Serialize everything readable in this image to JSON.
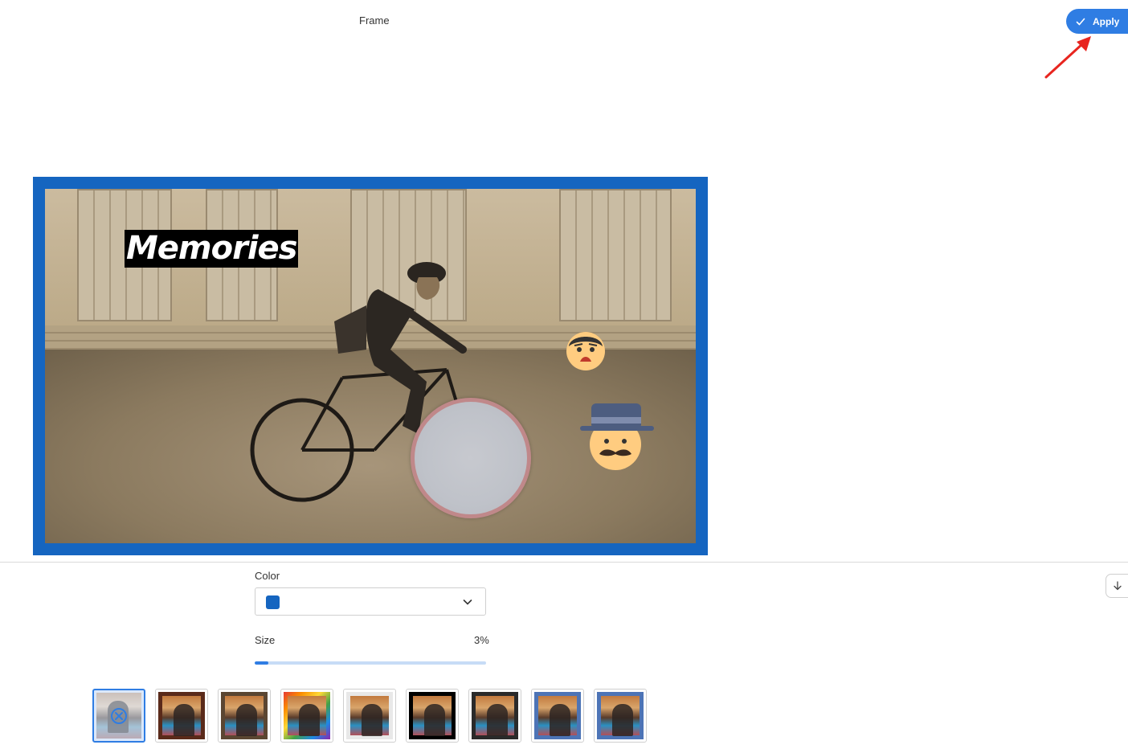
{
  "header": {
    "title": "Frame"
  },
  "toolbar": {
    "apply_label": "Apply"
  },
  "canvas": {
    "frame_color": "#1565c0",
    "overlay_text": "Memories",
    "stickers": [
      "worried-face-sticker",
      "man-with-hat-sticker"
    ],
    "blur_circle": "blur-circle"
  },
  "settings": {
    "color_label": "Color",
    "color_value": "#1565c0",
    "size_label": "Size",
    "size_value": "3%",
    "size_fraction": 0.06
  },
  "thumbnails": [
    {
      "id": "none",
      "selected": true
    },
    {
      "id": "frame-1",
      "selected": false,
      "border": "#5a2a1a"
    },
    {
      "id": "frame-2",
      "selected": false,
      "border": "#5b4632"
    },
    {
      "id": "frame-3",
      "selected": false,
      "border": "rainbow"
    },
    {
      "id": "frame-4",
      "selected": false,
      "border": "#e8e8e8"
    },
    {
      "id": "frame-5",
      "selected": false,
      "border": "#000000"
    },
    {
      "id": "frame-6",
      "selected": false,
      "border": "#2a2a2a"
    },
    {
      "id": "frame-7",
      "selected": false,
      "border": "#4d74b6"
    },
    {
      "id": "frame-8",
      "selected": false,
      "border": "#4d74b6"
    }
  ],
  "colors": {
    "accent": "#2f7de3",
    "annotation_arrow": "#e8251f"
  }
}
